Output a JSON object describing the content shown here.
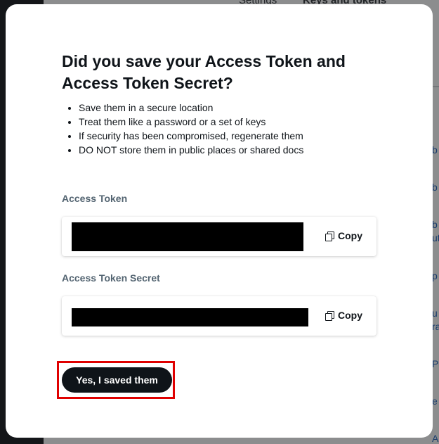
{
  "background": {
    "tabs": [
      "Settings",
      "Keys and tokens"
    ],
    "edge_fragments": [
      "b",
      "b",
      "b",
      "ut",
      "p",
      "u",
      "ra",
      "P",
      "e",
      "Ac"
    ]
  },
  "modal": {
    "title": "Did you save your Access Token and Access Token Secret?",
    "bullets": [
      "Save them in a secure location",
      "Treat them like a password or a set of keys",
      "If security has been compromised, regenerate them",
      "DO NOT store them in public places or shared docs"
    ],
    "fields": [
      {
        "label": "Access Token",
        "copy_label": "Copy"
      },
      {
        "label": "Access Token Secret",
        "copy_label": "Copy"
      }
    ],
    "confirm_button": "Yes, I saved them"
  },
  "colors": {
    "primary_text": "#0f1419",
    "label_text": "#536471",
    "button_bg": "#0f1419",
    "highlight": "#e00000"
  },
  "icons": {
    "copy": "copy-icon"
  }
}
